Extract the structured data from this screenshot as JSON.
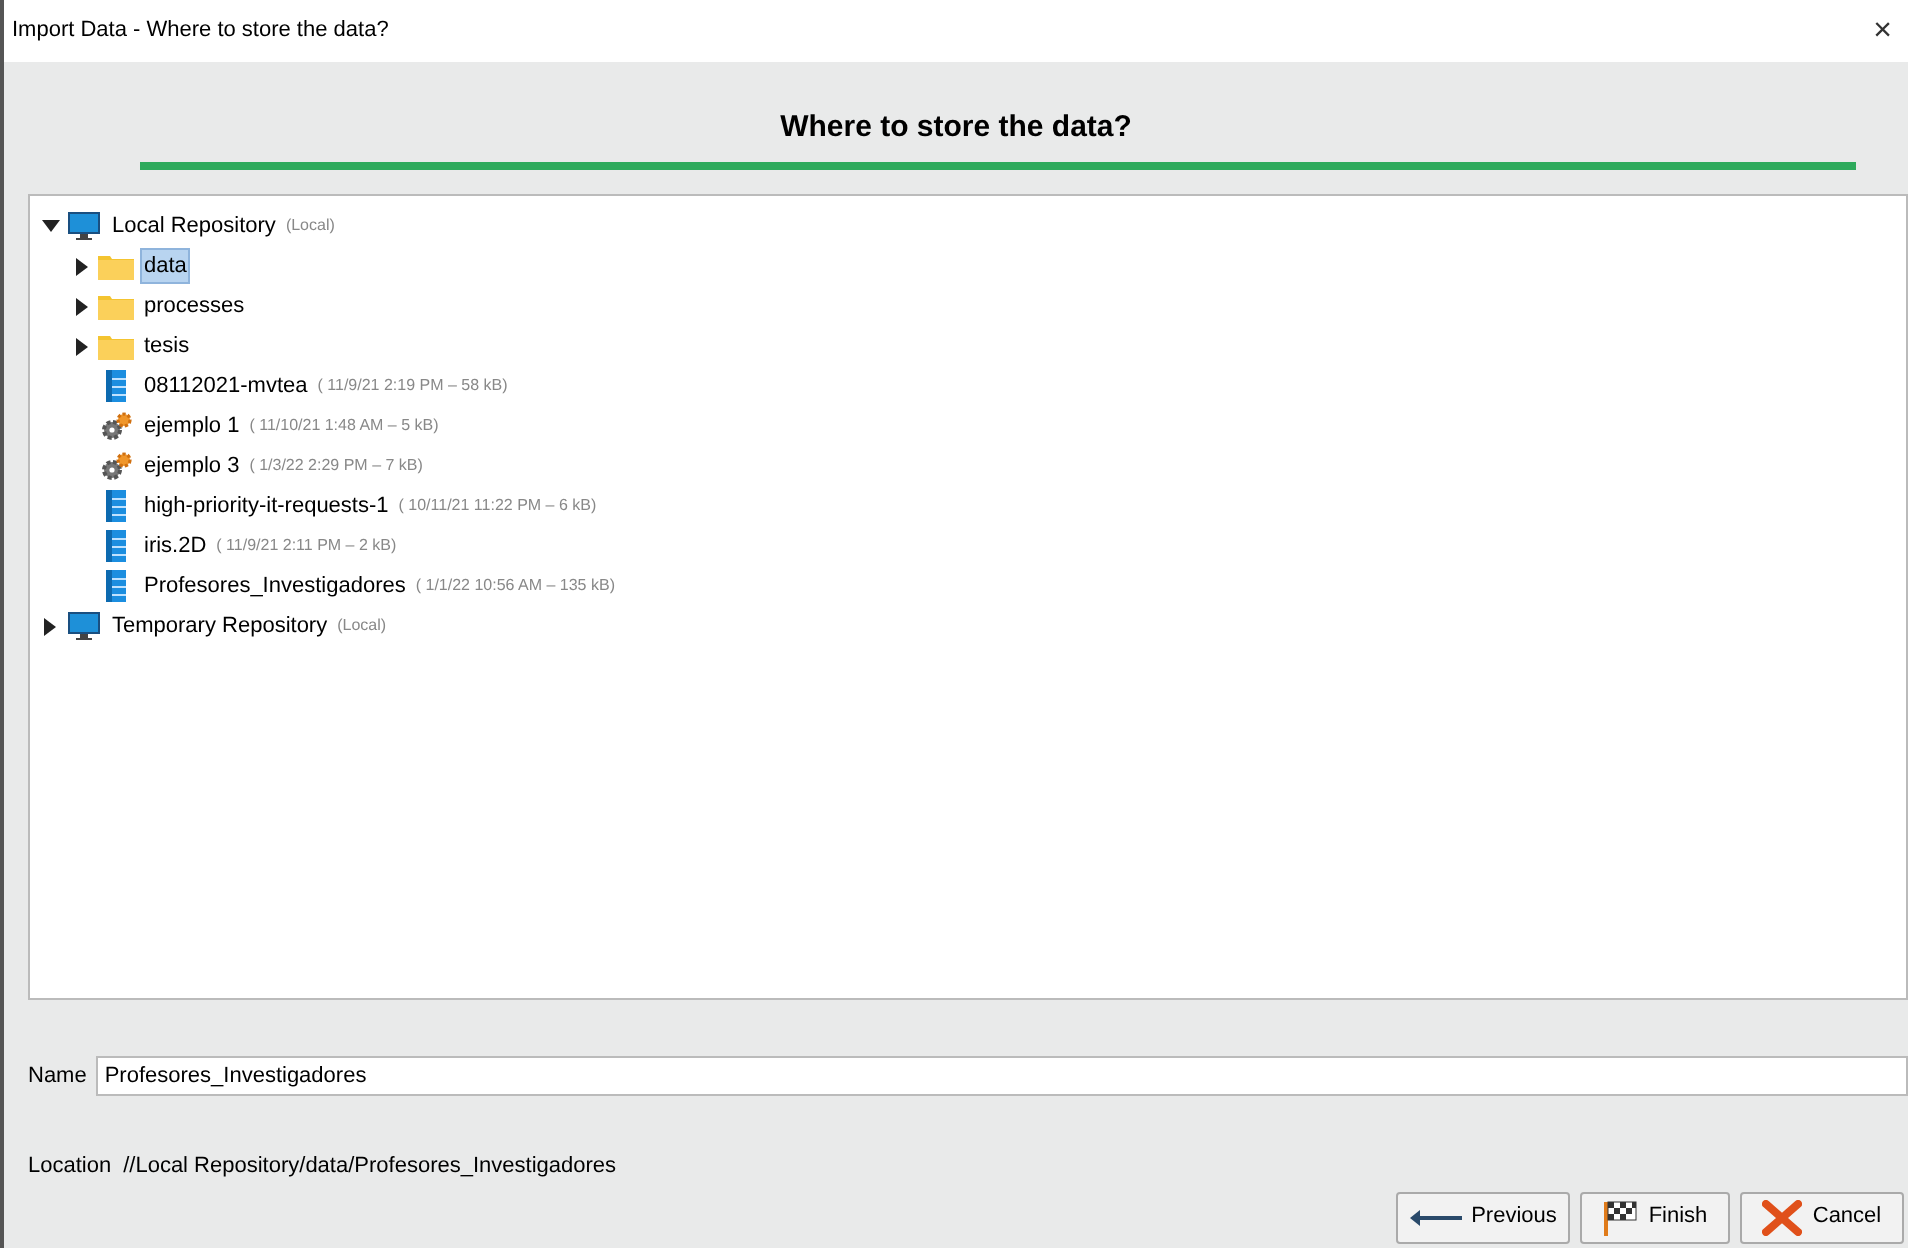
{
  "window": {
    "title": "Import Data - Where to store the data?",
    "close": "×"
  },
  "heading": "Where to store the data?",
  "tree": [
    {
      "kind": "repository",
      "label": "Local Repository",
      "note": "(Local)",
      "expanded": true,
      "selected": false,
      "children": [
        {
          "kind": "folder",
          "label": "data",
          "expanded": false,
          "selected": true
        },
        {
          "kind": "folder",
          "label": "processes",
          "expanded": false,
          "selected": false
        },
        {
          "kind": "folder",
          "label": "tesis",
          "expanded": false,
          "selected": false
        },
        {
          "kind": "data",
          "label": "08112021-mvtea",
          "note": "( 11/9/21 2:19 PM – 58 kB)",
          "selected": false
        },
        {
          "kind": "process",
          "label": "ejemplo 1",
          "note": "( 11/10/21 1:48 AM – 5 kB)",
          "selected": false
        },
        {
          "kind": "process",
          "label": "ejemplo 3",
          "note": "( 1/3/22 2:29 PM – 7 kB)",
          "selected": false
        },
        {
          "kind": "data",
          "label": "high-priority-it-requests-1",
          "note": "( 10/11/21 11:22 PM – 6 kB)",
          "selected": false
        },
        {
          "kind": "data",
          "label": "iris.2D",
          "note": "( 11/9/21 2:11 PM – 2 kB)",
          "selected": false
        },
        {
          "kind": "data",
          "label": "Profesores_Investigadores",
          "note": "( 1/1/22 10:56 AM – 135 kB)",
          "selected": false
        }
      ]
    },
    {
      "kind": "repository",
      "label": "Temporary Repository",
      "note": "(Local)",
      "expanded": false,
      "selected": false
    }
  ],
  "name_field": {
    "label": "Name",
    "value": "Profesores_Investigadores"
  },
  "location": {
    "label": "Location",
    "value": "//Local Repository/data/Profesores_Investigadores"
  },
  "buttons": [
    {
      "kind": "previous",
      "label": "Previous"
    },
    {
      "kind": "finish",
      "label": "Finish"
    },
    {
      "kind": "cancel",
      "label": "Cancel"
    }
  ]
}
